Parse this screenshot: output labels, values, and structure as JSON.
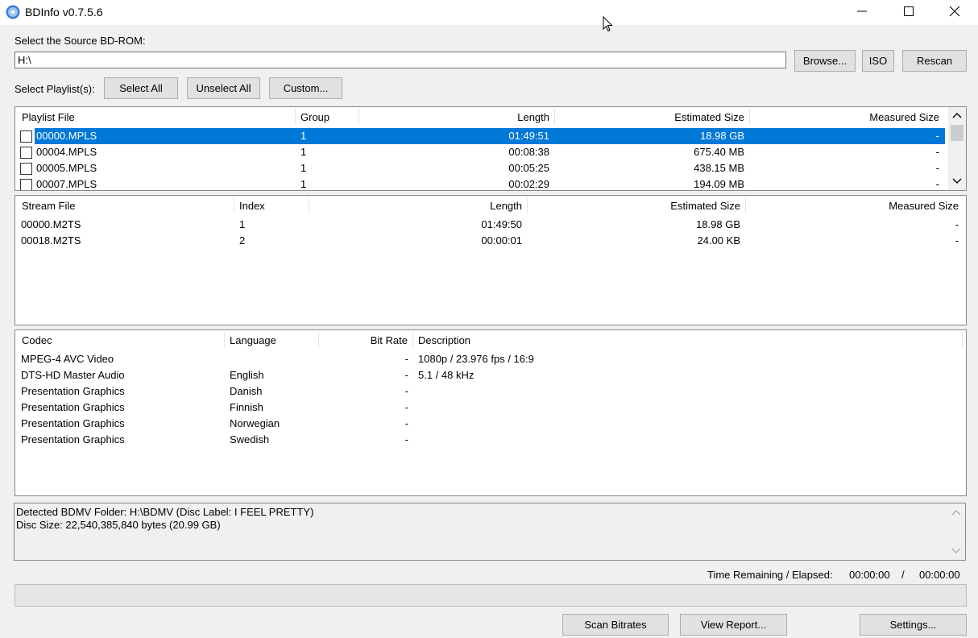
{
  "window": {
    "title": "BDInfo v0.7.5.6"
  },
  "source": {
    "label": "Select the Source BD-ROM:",
    "path": "H:\\"
  },
  "source_buttons": {
    "browse": "Browse...",
    "iso": "ISO",
    "rescan": "Rescan"
  },
  "playlist_select": {
    "label": "Select Playlist(s):",
    "select_all": "Select All",
    "unselect_all": "Unselect All",
    "custom": "Custom..."
  },
  "playlists": {
    "headers": [
      "Playlist File",
      "Group",
      "Length",
      "Estimated Size",
      "Measured Size"
    ],
    "rows": [
      {
        "file": "00000.MPLS",
        "group": "1",
        "length": "01:49:51",
        "est": "18.98 GB",
        "measured": "-"
      },
      {
        "file": "00004.MPLS",
        "group": "1",
        "length": "00:08:38",
        "est": "675.40 MB",
        "measured": "-"
      },
      {
        "file": "00005.MPLS",
        "group": "1",
        "length": "00:05:25",
        "est": "438.15 MB",
        "measured": "-"
      },
      {
        "file": "00007.MPLS",
        "group": "1",
        "length": "00:02:29",
        "est": "194.09 MB",
        "measured": "-"
      }
    ]
  },
  "streams": {
    "headers": [
      "Stream File",
      "Index",
      "Length",
      "Estimated Size",
      "Measured Size"
    ],
    "rows": [
      {
        "file": "00000.M2TS",
        "index": "1",
        "length": "01:49:50",
        "est": "18.98 GB",
        "measured": "-"
      },
      {
        "file": "00018.M2TS",
        "index": "2",
        "length": "00:00:01",
        "est": "24.00 KB",
        "measured": "-"
      }
    ]
  },
  "codecs": {
    "headers": [
      "Codec",
      "Language",
      "Bit Rate",
      "Description"
    ],
    "rows": [
      {
        "codec": "MPEG-4 AVC Video",
        "language": "",
        "bitrate": "-",
        "desc": "1080p / 23.976 fps / 16:9"
      },
      {
        "codec": "DTS-HD Master Audio",
        "language": "English",
        "bitrate": "-",
        "desc": "5.1 / 48 kHz"
      },
      {
        "codec": "Presentation Graphics",
        "language": "Danish",
        "bitrate": "-",
        "desc": ""
      },
      {
        "codec": "Presentation Graphics",
        "language": "Finnish",
        "bitrate": "-",
        "desc": ""
      },
      {
        "codec": "Presentation Graphics",
        "language": "Norwegian",
        "bitrate": "-",
        "desc": ""
      },
      {
        "codec": "Presentation Graphics",
        "language": "Swedish",
        "bitrate": "-",
        "desc": ""
      }
    ]
  },
  "info": {
    "line1": "Detected BDMV Folder: H:\\BDMV (Disc Label: I FEEL PRETTY)",
    "line2": "Disc Size: 22,540,385,840 bytes (20.99 GB)"
  },
  "time": {
    "label": "Time Remaining / Elapsed:",
    "remaining": "00:00:00",
    "separator": "/",
    "elapsed": "00:00:00"
  },
  "progress": {
    "value": 0
  },
  "bottom_buttons": {
    "scan": "Scan Bitrates",
    "view": "View Report...",
    "settings": "Settings..."
  }
}
